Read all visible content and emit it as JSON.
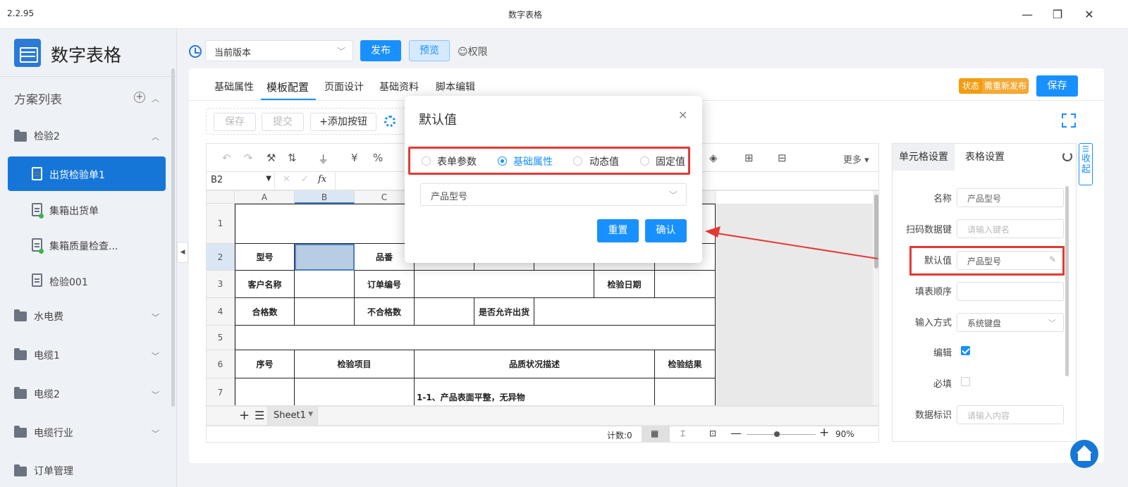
{
  "window": {
    "version": "2.2.95",
    "title": "数字表格",
    "min_icon": "minimize-icon",
    "restore_icon": "restore-icon",
    "close_icon": "close-icon"
  },
  "sidebar": {
    "app_name": "数字表格",
    "section_title": "方案列表",
    "items": [
      {
        "type": "folder",
        "label": "检验2",
        "expanded": true
      },
      {
        "type": "doc",
        "label": "出货检验单1",
        "active": true
      },
      {
        "type": "doc",
        "label": "集箱出货单"
      },
      {
        "type": "doc",
        "label": "集箱质量检查..."
      },
      {
        "type": "doc",
        "label": "检验001"
      },
      {
        "type": "folder",
        "label": "水电费"
      },
      {
        "type": "folder",
        "label": "电缆1"
      },
      {
        "type": "folder",
        "label": "电缆2"
      },
      {
        "type": "folder",
        "label": "电缆行业"
      },
      {
        "type": "folder",
        "label": "订单管理"
      }
    ]
  },
  "topbar": {
    "version_value": "当前版本",
    "publish": "发布",
    "preview": "预览",
    "permission": "权限"
  },
  "tabs": [
    "基础属性",
    "模板配置",
    "页面设计",
    "基础资料",
    "脚本编辑"
  ],
  "active_tab": "模板配置",
  "status": {
    "label": "状态",
    "value": "需重新发布",
    "color": "#f39c12"
  },
  "save_top": "保存",
  "toolbar2": {
    "save": "保存",
    "submit": "提交",
    "add": "+添加按钮"
  },
  "sheet": {
    "more": "更多",
    "name_box": "B2",
    "fx": "fx",
    "columns": [
      "A",
      "B",
      "C"
    ],
    "rows": [
      "1",
      "2",
      "3",
      "4",
      "5",
      "6",
      "7"
    ],
    "cells": {
      "model": "型号",
      "product": "品番",
      "customer": "客户名称",
      "order_no": "订单编号",
      "inspect_date": "检验日期",
      "qualified": "合格数",
      "unqualified": "不合格数",
      "allow_ship": "是否允许出货",
      "seq": "序号",
      "inspect_item": "检验项目",
      "quality_desc": "品质状况描述",
      "inspect_result": "检验结果",
      "row7": "1-1、产品表面平整，无异物"
    },
    "sheet_tab": "Sheet1",
    "count": "计数:0",
    "zoom": "90%"
  },
  "right_panel": {
    "tab_cell": "单元格设置",
    "tab_table": "表格设置",
    "fields": {
      "name_label": "名称",
      "name_value": "产品型号",
      "scan_label": "扫码数据键",
      "scan_ph": "请输入键名",
      "default_label": "默认值",
      "default_value": "产品型号",
      "order_label": "填表顺序",
      "input_label": "输入方式",
      "input_value": "系统键盘",
      "edit_label": "编辑",
      "edit_checked": true,
      "required_label": "必填",
      "required_checked": false,
      "tag_label": "数据标识",
      "tag_ph": "请输入内容"
    },
    "collapse": "收起"
  },
  "modal": {
    "title": "默认值",
    "options": [
      "表单参数",
      "基础属性",
      "动态值",
      "固定值"
    ],
    "selected": "基础属性",
    "select_value": "产品型号",
    "reset": "重置",
    "confirm": "确认"
  }
}
